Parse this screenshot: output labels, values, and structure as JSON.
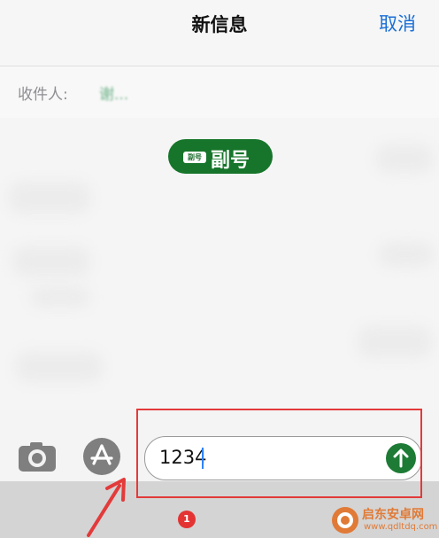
{
  "header": {
    "title": "新信息",
    "cancel_label": "取消"
  },
  "recipient": {
    "label": "收件人:",
    "name": "谢..."
  },
  "line_badge": {
    "mini_chip": "副号",
    "label": "副号"
  },
  "composer": {
    "text": "1234"
  },
  "annotation": {
    "step": "1"
  },
  "watermark": {
    "brand": "启东安卓网",
    "url": "www.qdltdq.com"
  },
  "icons": {
    "camera": "camera-icon",
    "app_store": "app-store-icon",
    "send": "send-arrow-icon"
  },
  "colors": {
    "green": "#16752a",
    "blue": "#1a6fd6",
    "red": "#e33a3a",
    "orange": "#e07a36"
  }
}
